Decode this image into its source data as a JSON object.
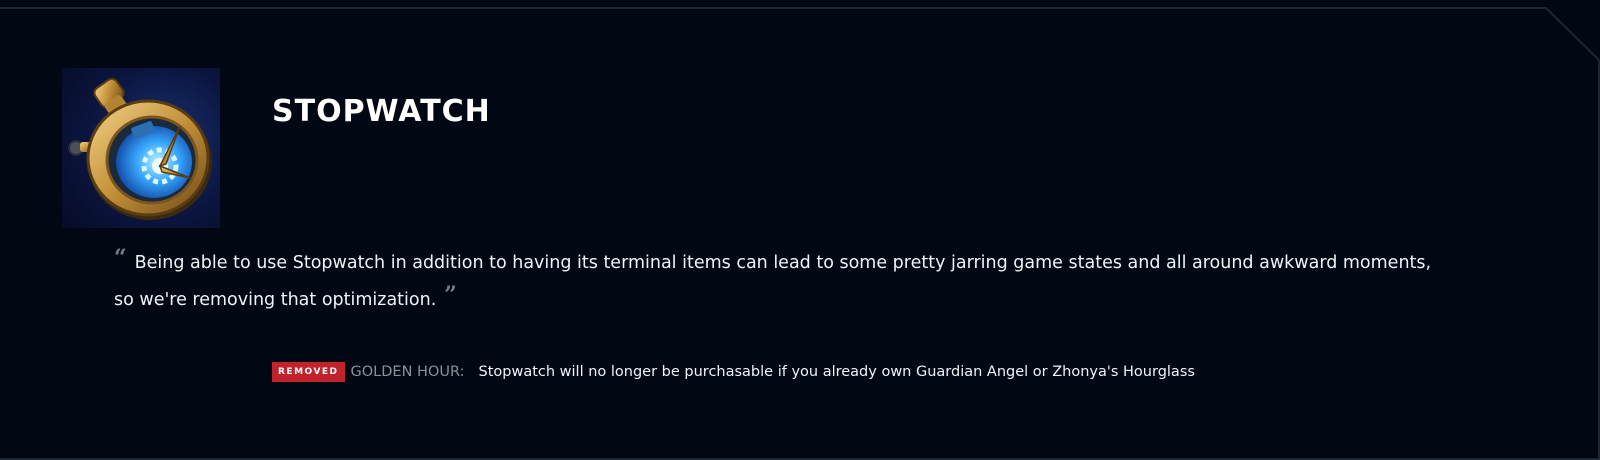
{
  "item": {
    "name": "STOPWATCH",
    "icon": "stopwatch-icon"
  },
  "quote": {
    "text": "Being able to use Stopwatch in addition to having its terminal items can lead to some pretty jarring game states and all around awkward moments, so we're removing that optimization.",
    "open_mark": "“",
    "close_mark": "”"
  },
  "change": {
    "tag": "REMOVED",
    "attribute": "GOLDEN HOUR:",
    "description": "Stopwatch will no longer be purchasable if you already own Guardian Angel or Zhonya's Hourglass"
  },
  "colors": {
    "background": "#010713",
    "frame": "#1d2633",
    "tag": "#c0232b",
    "title": "#ffffff",
    "body_text": "#f0f3f7",
    "muted_text": "#8c9097"
  }
}
